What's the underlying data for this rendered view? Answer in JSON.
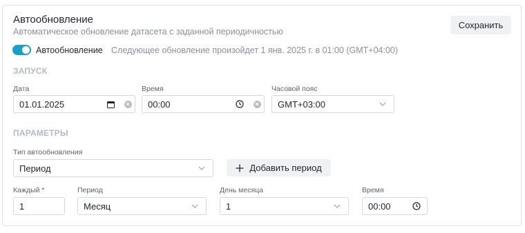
{
  "header": {
    "title": "Автообновление",
    "subtitle": "Автоматическое обновление датасета с заданной периодичностью",
    "save_label": "Сохранить"
  },
  "toggle": {
    "label": "Автообновление",
    "enabled": true,
    "next_update": "Следующее обновление произойдет 1 янв. 2025 г. в 01:00 (GMT+04:00)"
  },
  "launch": {
    "section_title": "ЗАПУСК",
    "date_label": "Дата",
    "date_value": "01.01.2025",
    "time_label": "Время",
    "time_value": "00:00",
    "timezone_label": "Часовой пояс",
    "timezone_value": "GMT+03:00"
  },
  "params": {
    "section_title": "ПАРАМЕТРЫ",
    "type_label": "Тип автообновления",
    "type_value": "Период",
    "add_period_label": "Добавить период",
    "every_label": "Каждый *",
    "every_value": "1",
    "period_label": "Период",
    "period_value": "Месяц",
    "day_label": "День месяца",
    "day_value": "1",
    "time_label": "Время",
    "time_value": "00:00"
  },
  "colors": {
    "accent": "#1aa0c8",
    "section_text": "#b4bac2",
    "muted_text": "#8a9099",
    "button_bg": "#f0f1f3"
  }
}
